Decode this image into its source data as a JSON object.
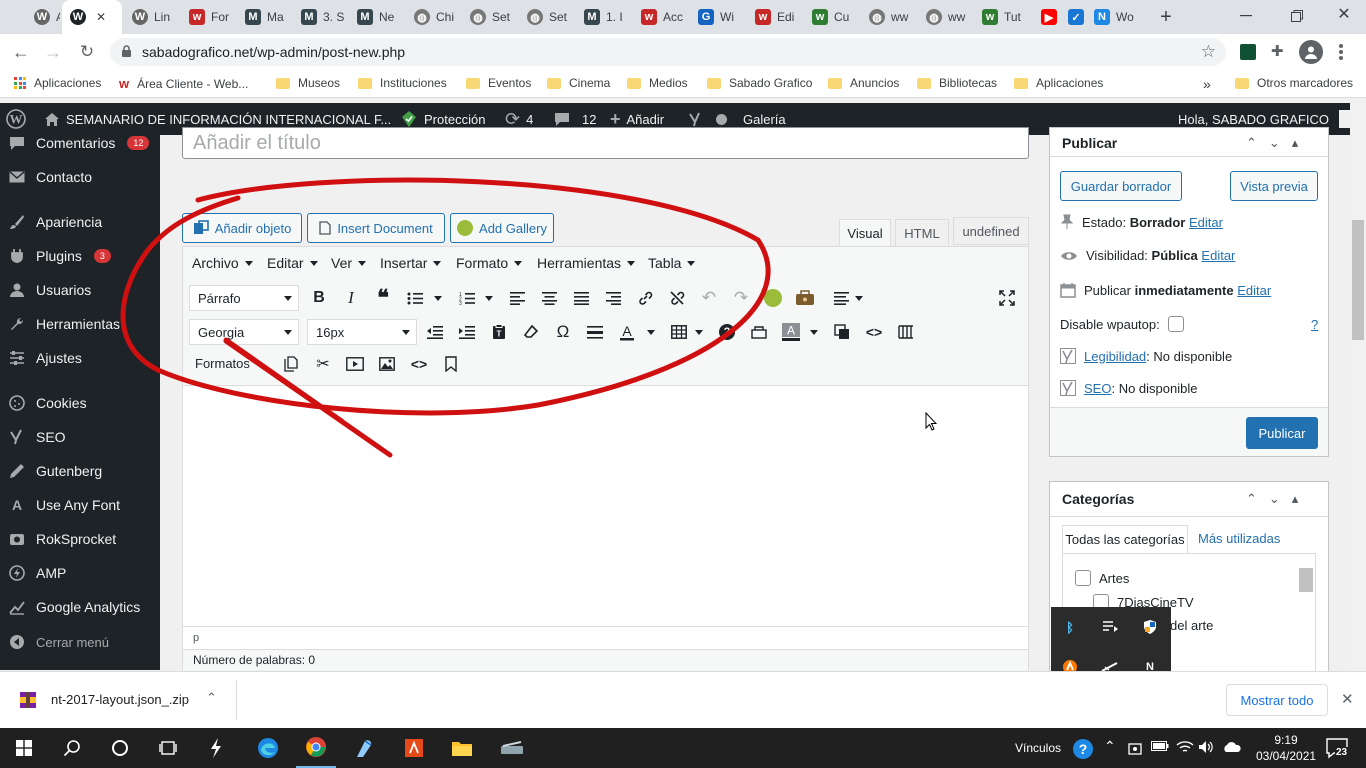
{
  "browser": {
    "tabs": [
      {
        "label": "Adi",
        "icon": "wordpress",
        "color": "#666666"
      },
      {
        "label": "",
        "icon": "wordpress",
        "color": "#1d2327",
        "active": true
      },
      {
        "label": "Lin",
        "icon": "wordpress",
        "color": "#666666"
      },
      {
        "label": "For",
        "icon": "w-red",
        "color": "#c62828"
      },
      {
        "label": "Ma",
        "icon": "M",
        "color": "#37474f"
      },
      {
        "label": "3. S",
        "icon": "M",
        "color": "#37474f"
      },
      {
        "label": "Ne",
        "icon": "M",
        "color": "#37474f"
      },
      {
        "label": "Chi",
        "icon": "globe",
        "color": "#777777"
      },
      {
        "label": "Set",
        "icon": "globe",
        "color": "#777777"
      },
      {
        "label": "Set",
        "icon": "globe",
        "color": "#777777"
      },
      {
        "label": "1. I",
        "icon": "M",
        "color": "#37474f"
      },
      {
        "label": "Acc",
        "icon": "w-red",
        "color": "#c62828"
      },
      {
        "label": "Wi",
        "icon": "g-blue",
        "color": "#1565c0"
      },
      {
        "label": "Edi",
        "icon": "w-red",
        "color": "#c62828"
      },
      {
        "label": "Cu",
        "icon": "w-green",
        "color": "#2e7d32"
      },
      {
        "label": "ww",
        "icon": "globe",
        "color": "#777777"
      },
      {
        "label": "ww",
        "icon": "globe",
        "color": "#777777"
      },
      {
        "label": "Tut",
        "icon": "w-green",
        "color": "#2e7d32"
      },
      {
        "label": "",
        "icon": "youtube",
        "color": "#ff0000"
      },
      {
        "label": "",
        "icon": "check",
        "color": "#1976d2"
      },
      {
        "label": "Wo",
        "icon": "N",
        "color": "#1e88e5"
      }
    ],
    "url": "sabadografico.net/wp-admin/post-new.php",
    "bookmarks": [
      "Aplicaciones",
      "Área Cliente - Web...",
      "Museos",
      "Instituciones",
      "Eventos",
      "Cinema",
      "Medios",
      "Sabado Grafico",
      "Anuncios",
      "Bibliotecas",
      "Aplicaciones"
    ],
    "other_bookmarks": "Otros marcadores"
  },
  "adminbar": {
    "site": "SEMANARIO DE INFORMACIÓN INTERNACIONAL F...",
    "protection": "Protección",
    "updates": "4",
    "comments": "12",
    "add": "Añadir",
    "gallery": "Galería",
    "greeting": "Hola, SABADO GRAFICO"
  },
  "sidebar": {
    "items": [
      {
        "label": "Comentarios",
        "icon": "comment-icon",
        "badge": "12"
      },
      {
        "label": "Contacto",
        "icon": "mail-icon"
      },
      {
        "label": "Apariencia",
        "icon": "brush-icon"
      },
      {
        "label": "Plugins",
        "icon": "plugin-icon",
        "badge": "3"
      },
      {
        "label": "Usuarios",
        "icon": "user-icon"
      },
      {
        "label": "Herramientas",
        "icon": "wrench-icon"
      },
      {
        "label": "Ajustes",
        "icon": "settings-icon"
      },
      {
        "label": "Cookies",
        "icon": "cookie-icon"
      },
      {
        "label": "SEO",
        "icon": "yoast-icon"
      },
      {
        "label": "Gutenberg",
        "icon": "pen-icon"
      },
      {
        "label": "Use Any Font",
        "icon": "font-icon"
      },
      {
        "label": "RokSprocket",
        "icon": "rok-icon"
      },
      {
        "label": "AMP",
        "icon": "amp-icon"
      },
      {
        "label": "Google Analytics",
        "icon": "analytics-icon"
      }
    ],
    "collapse": "Cerrar menú"
  },
  "editor": {
    "title_placeholder": "Añadir el título",
    "add_object": "Añadir objeto",
    "insert_document": "Insert Document",
    "add_gallery": "Add Gallery",
    "tabs": [
      "Visual",
      "HTML",
      "undefined"
    ],
    "menu": [
      "Archivo",
      "Editar",
      "Ver",
      "Insertar",
      "Formato",
      "Herramientas",
      "Tabla"
    ],
    "paragraph_select": "Párrafo",
    "font_select": "Georgia",
    "size_select": "16px",
    "formats": "Formatos",
    "path": "p",
    "word_count": "Número de palabras: 0"
  },
  "publish": {
    "title": "Publicar",
    "save_draft": "Guardar borrador",
    "preview": "Vista previa",
    "status_label": "Estado:",
    "status_value": "Borrador",
    "visibility_label": "Visibilidad:",
    "visibility_value": "Pública",
    "publish_label": "Publicar",
    "publish_value": "inmediatamente",
    "edit": "Editar",
    "disable_wpautop": "Disable wpautop:",
    "help": "?",
    "readability": "Legibilidad",
    "readability_value": ": No disponible",
    "seo": "SEO",
    "seo_value": ": No disponible",
    "publish_button": "Publicar"
  },
  "categories": {
    "title": "Categorías",
    "tab_all": "Todas las categorías",
    "tab_used": "Más utilizadas",
    "items": [
      "Artes",
      "7DiasCineTV",
      "del arte"
    ]
  },
  "download": {
    "filename": "nt-2017-layout.json_.zip",
    "show_all": "Mostrar todo"
  },
  "taskbar": {
    "links": "Vínculos",
    "time": "9:19",
    "date": "03/04/2021",
    "notifications": "23"
  },
  "colors": {
    "wp_blue": "#2271b1",
    "admin_dark": "#1d2327",
    "badge_red": "#d63638",
    "annotation_red": "#d01010"
  }
}
